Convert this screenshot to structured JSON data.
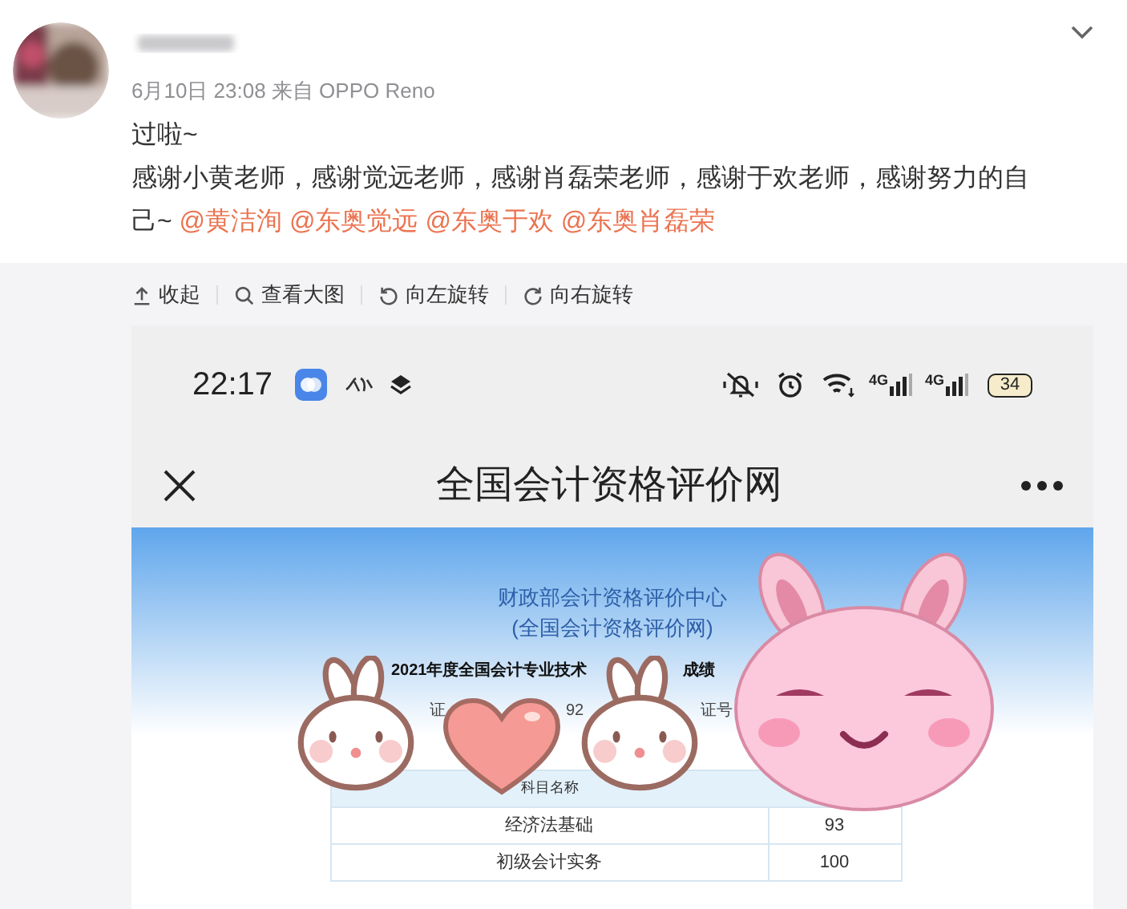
{
  "post": {
    "meta": "6月10日 23:08 来自 OPPO Reno",
    "title": "过啦~",
    "body": "感谢小黄老师，感谢觉远老师，感谢肖磊荣老师，感谢于欢老师，感谢努力的自己~",
    "mentions": [
      "@黄洁洵",
      "@东奥觉远",
      "@东奥于欢",
      "@东奥肖磊荣"
    ]
  },
  "actions": [
    {
      "kind": "collapse",
      "label": "收起"
    },
    {
      "kind": "zoom",
      "label": "查看大图"
    },
    {
      "kind": "rotate-left",
      "label": "向左旋转"
    },
    {
      "kind": "rotate-right",
      "label": "向右旋转"
    }
  ],
  "phone": {
    "time": "22:17",
    "network_labels": [
      "4G",
      "4G"
    ],
    "battery": "34",
    "page_title": "全国会计资格评价网",
    "web": {
      "heading_lines": [
        "财政部会计资格评价中心",
        "(全国会计资格评价网)"
      ],
      "subtitle_visible": "2021年度全国会计专业技术",
      "subtitle_fragment": "成绩",
      "fragments": [
        "证",
        "92",
        "证号"
      ],
      "table": {
        "header": "科目名称",
        "rows": [
          {
            "subject": "经济法基础",
            "score": "93"
          },
          {
            "subject": "初级会计实务",
            "score": "100"
          }
        ]
      }
    }
  }
}
